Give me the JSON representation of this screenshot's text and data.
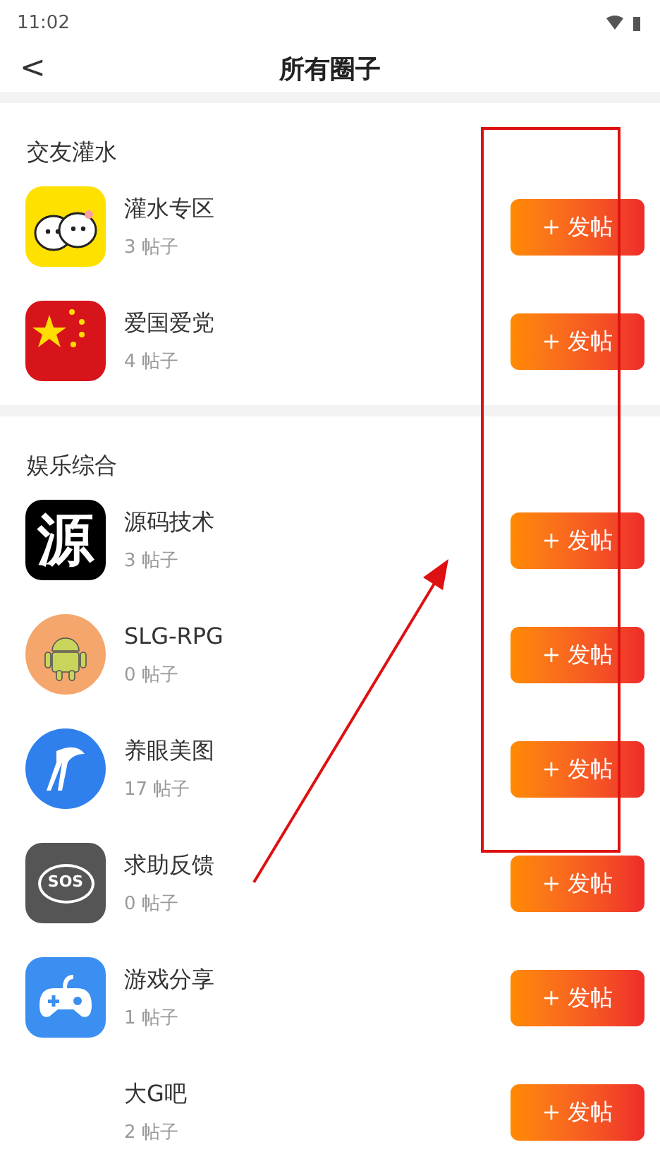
{
  "status_bar": {
    "time": "11:02"
  },
  "header": {
    "back": "<",
    "title": "所有圈子"
  },
  "sections": [
    {
      "title": "交友灌水",
      "items": [
        {
          "name": "灌水专区",
          "count": "3 帖子",
          "icon": {
            "kind": "bubbles"
          },
          "button": "+ 发帖"
        },
        {
          "name": "爱国爱党",
          "count": "4 帖子",
          "icon": {
            "kind": "flag"
          },
          "button": "+ 发帖"
        }
      ]
    },
    {
      "title": "娱乐综合",
      "items": [
        {
          "name": "源码技术",
          "count": "3 帖子",
          "icon": {
            "kind": "glyph",
            "text": "源"
          },
          "button": "+ 发帖"
        },
        {
          "name": "SLG-RPG",
          "count": "0 帖子",
          "icon": {
            "kind": "android"
          },
          "button": "+ 发帖"
        },
        {
          "name": "养眼美图",
          "count": "17 帖子",
          "icon": {
            "kind": "legs"
          },
          "button": "+ 发帖"
        },
        {
          "name": "求助反馈",
          "count": "0 帖子",
          "icon": {
            "kind": "sos",
            "text": "SOS"
          },
          "button": "+ 发帖"
        },
        {
          "name": "游戏分享",
          "count": "1 帖子",
          "icon": {
            "kind": "gamepad"
          },
          "button": "+ 发帖"
        },
        {
          "name": "大G吧",
          "count": "2 帖子",
          "icon": {
            "kind": "none"
          },
          "button": "+ 发帖"
        }
      ]
    }
  ]
}
